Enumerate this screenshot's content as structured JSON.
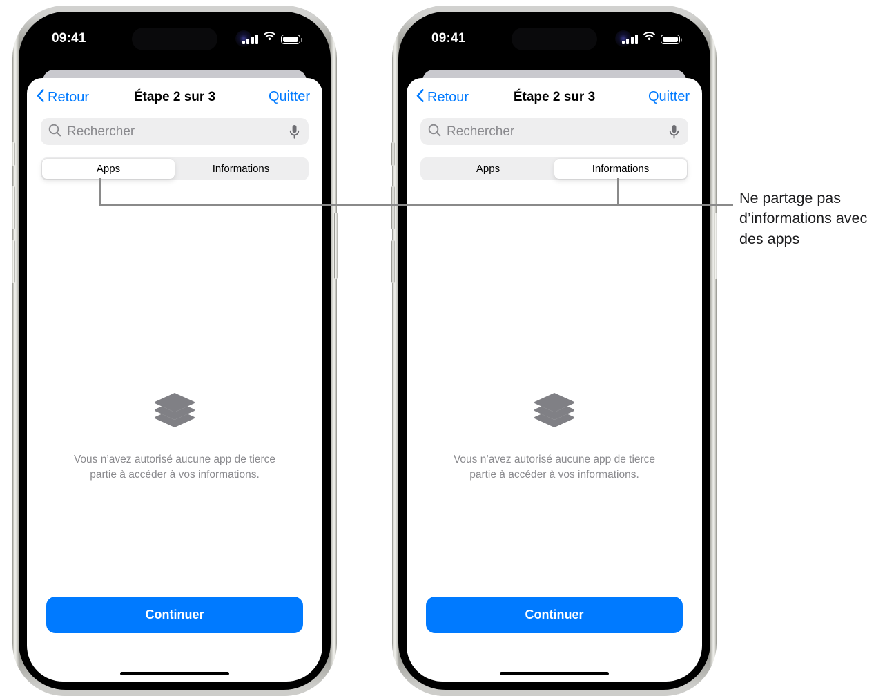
{
  "phones": [
    {
      "id": "left",
      "status_bar": {
        "time": "09:41",
        "cellular_icon": "cellular-signal-icon",
        "wifi_icon": "wifi-icon",
        "battery_icon": "battery-icon"
      },
      "nav": {
        "back_label": "Retour",
        "back_icon": "chevron-left-icon",
        "title": "Étape 2 sur 3",
        "quit_label": "Quitter"
      },
      "search": {
        "placeholder": "Rechercher",
        "search_icon": "search-icon",
        "mic_icon": "microphone-icon"
      },
      "segmented": {
        "options": [
          "Apps",
          "Informations"
        ],
        "selected_index": 0
      },
      "empty_state": {
        "icon": "stack-layers-icon",
        "message": "Vous n’avez autorisé aucune app de tierce partie à accéder à vos informations."
      },
      "cta_label": "Continuer"
    },
    {
      "id": "right",
      "status_bar": {
        "time": "09:41",
        "cellular_icon": "cellular-signal-icon",
        "wifi_icon": "wifi-icon",
        "battery_icon": "battery-icon"
      },
      "nav": {
        "back_label": "Retour",
        "back_icon": "chevron-left-icon",
        "title": "Étape 2 sur 3",
        "quit_label": "Quitter"
      },
      "search": {
        "placeholder": "Rechercher",
        "search_icon": "search-icon",
        "mic_icon": "microphone-icon"
      },
      "segmented": {
        "options": [
          "Apps",
          "Informations"
        ],
        "selected_index": 1
      },
      "empty_state": {
        "icon": "stack-layers-icon",
        "message": "Vous n’avez autorisé aucune app de tierce partie à accéder à vos informations."
      },
      "cta_label": "Continuer"
    }
  ],
  "callout": {
    "text": "Ne partage pas d’informations avec des apps",
    "leader_color": "#8a8a8a"
  },
  "colors": {
    "accent_blue": "#007AFF",
    "secondary_text": "#8a8a8e",
    "field_bg": "#eeeeef",
    "sheet_behind": "#c9c9ce"
  }
}
